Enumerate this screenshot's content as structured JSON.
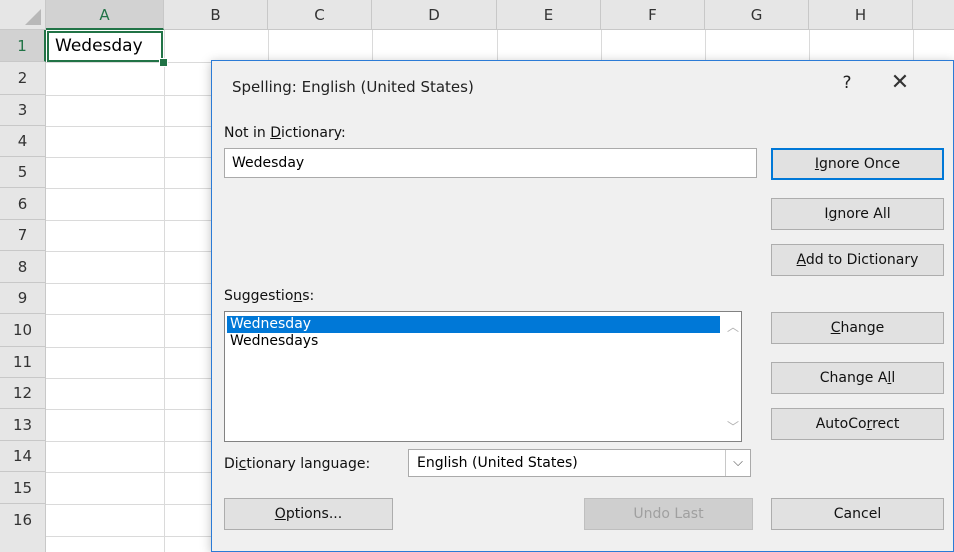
{
  "sheet": {
    "columns": [
      "A",
      "B",
      "C",
      "D",
      "E",
      "F",
      "G",
      "H"
    ],
    "rows": [
      "1",
      "2",
      "3",
      "4",
      "5",
      "6",
      "7",
      "8",
      "9",
      "10",
      "11",
      "12",
      "13",
      "14",
      "15",
      "16"
    ],
    "a1_value": "Wedesday"
  },
  "dialog": {
    "title": "Spelling: English (United States)",
    "help": "?",
    "close": "✕",
    "not_in_dictionary_label": [
      "Not in ",
      "D",
      "ictionary:"
    ],
    "not_in_dictionary_value": "Wedesday",
    "suggestions_label": [
      "Suggestio",
      "n",
      "s:"
    ],
    "suggestions": [
      "Wednesday",
      "Wednesdays"
    ],
    "selected_suggestion": 0,
    "dictionary_language_label": [
      "Di",
      "c",
      "tionary language:"
    ],
    "dictionary_language_value": "English (United States)",
    "buttons": {
      "ignore_once": [
        "",
        "I",
        "gnore Once"
      ],
      "ignore_all": [
        "I",
        "g",
        "nore All"
      ],
      "add_to_dictionary": [
        "",
        "A",
        "dd to Dictionary"
      ],
      "change": [
        "",
        "C",
        "hange"
      ],
      "change_all": [
        "Change A",
        "l",
        "l"
      ],
      "autocorrect": [
        "AutoCo",
        "r",
        "rect"
      ],
      "options": [
        "",
        "O",
        "ptions..."
      ],
      "undo_last": "Undo Last",
      "cancel": "Cancel"
    }
  }
}
